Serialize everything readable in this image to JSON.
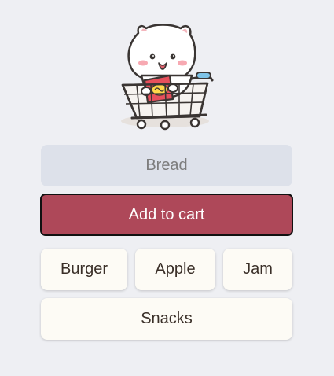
{
  "illustration": {
    "icon": "cat-in-shopping-cart-icon"
  },
  "input": {
    "placeholder": "Bread",
    "value": ""
  },
  "primary": {
    "label": "Add to cart"
  },
  "choices": {
    "burger": "Burger",
    "apple": "Apple",
    "jam": "Jam",
    "snacks": "Snacks"
  },
  "colors": {
    "background": "#eeeff3",
    "input_bg": "#dde1ea",
    "primary_bg": "#ae4859",
    "chip_bg": "#fdfbf5"
  }
}
